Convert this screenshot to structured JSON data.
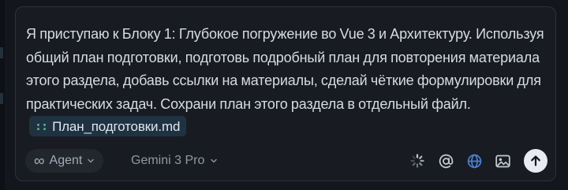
{
  "composer": {
    "message_text": "Я приступаю к Блоку 1: Глубокое погружение во Vue 3 и Архитектуру. Используя общий план подготовки, подготовь подробный план для повторения материала этого раздела, добавь ссылки на материалы, сделай чёткие формулировки для практических задач. Сохрани план этого раздела в отдельный файл.",
    "file_chip": {
      "icon": "file-icon",
      "label": "План_подготовки.md"
    }
  },
  "toolbar": {
    "mode": {
      "icon": "infinity-icon",
      "label": "Agent"
    },
    "model": {
      "label": "Gemini 3 Pro"
    },
    "tools": [
      "loading-spinner-icon",
      "at-mention-icon",
      "globe-icon",
      "image-icon",
      "send-arrow-icon"
    ]
  },
  "colors": {
    "background": "#13171d",
    "composer_bg": "#181c22",
    "chip_bg": "#1f3241",
    "chip_icon": "#4fbf8c",
    "globe_accent": "#4a7fd4",
    "send_bg": "#e8ebef"
  }
}
